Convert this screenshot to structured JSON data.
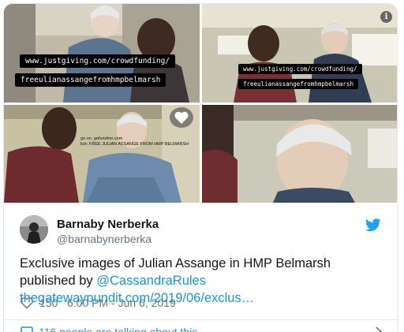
{
  "media": {
    "tile1": {
      "caption_line1": "www.justgiving.com/crowdfunding/",
      "caption_line2": "freeulianassangefromhmpbelmarsh"
    },
    "tile2": {
      "caption_line1": "www.justgiving.com/crowdfunding/",
      "caption_line2": "freeulianassangefromhmpbelmarsh"
    },
    "tile3": {
      "caption_line1": "go on. gofundme.com",
      "caption_line2": "lick: FREE JULIAN ASSANGE FROM HMP BELMARSH"
    },
    "info_icon": "i"
  },
  "author": {
    "display_name": "Barnaby Nerberka",
    "handle": "@barnabynerberka"
  },
  "tweet": {
    "text_before": "Exclusive images of Julian Assange in HMP Belmarsh published by ",
    "mention": "@CassandraRules",
    "link": "thegatewaypundit.com/2019/06/exclus…"
  },
  "meta": {
    "likes": "150",
    "timestamp": "6:00 PM - Jun 6, 2019"
  },
  "footer": {
    "talking": "116 people are talking about this"
  },
  "icons": {
    "brand": "twitter-bird-icon",
    "like": "heart-icon",
    "reply": "speech-bubble-icon",
    "more": "chevron-right-icon"
  },
  "colors": {
    "link": "#1b95e0",
    "secondary_text": "#657786",
    "border": "#e1e8ed",
    "twitter_blue": "#1da1f2"
  }
}
